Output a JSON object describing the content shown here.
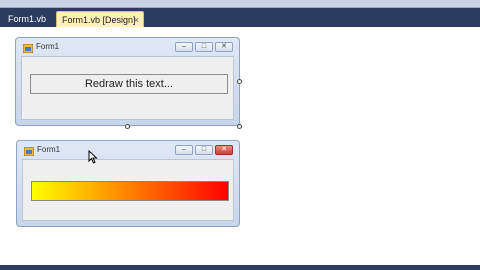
{
  "ide": {
    "tabs": [
      {
        "label": "Form1.vb",
        "active": false
      },
      {
        "label": "Form1.vb [Design]",
        "active": true
      }
    ],
    "close_glyph": "×"
  },
  "form_top": {
    "title": "Form1",
    "button_label": "Redraw this text...",
    "window_buttons": [
      "minimize-icon",
      "maximize-icon",
      "close-icon"
    ]
  },
  "form_bottom": {
    "title": "Form1",
    "gradient_colors": [
      "#ffff00",
      "#ff0000"
    ],
    "window_buttons": [
      "minimize-icon",
      "maximize-icon",
      "close-icon"
    ]
  }
}
